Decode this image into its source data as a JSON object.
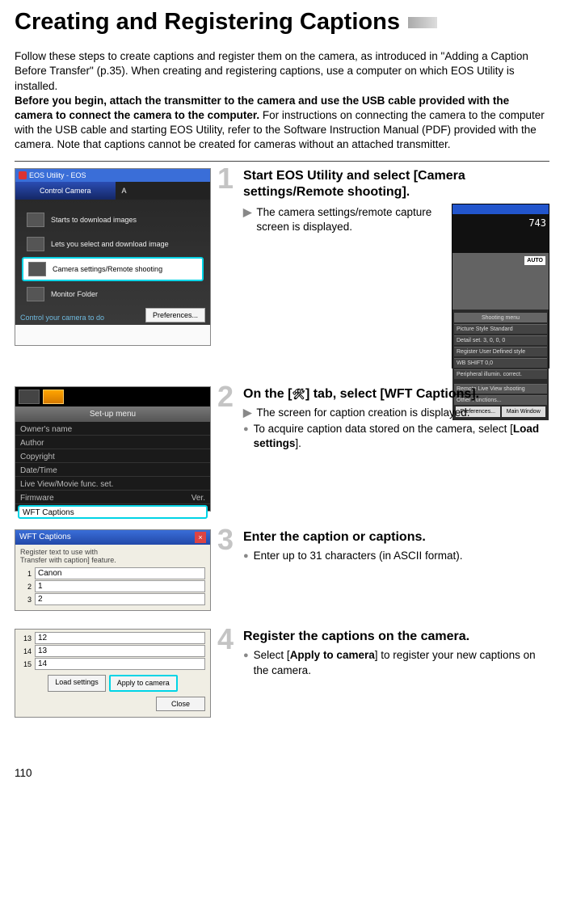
{
  "title": "Creating and Registering Captions",
  "intro_p1": "Follow these steps to create captions and register them on the camera, as introduced in \"Adding a Caption Before Transfer\" (p.35). When creating and registering captions, use a computer on which EOS Utility is installed.",
  "intro_bold": "Before you begin, attach the transmitter to the camera and use the USB cable provided with the camera to connect the camera to the computer.",
  "intro_p2": " For instructions on connecting the camera to the computer with the USB cable and starting EOS Utility, refer to the Software Instruction Manual (PDF) provided with the camera. Note that captions cannot be created for cameras without an attached transmitter.",
  "page_number": "110",
  "steps": {
    "1": {
      "num": "1",
      "title": "Start EOS Utility and select [Camera settings/Remote shooting].",
      "b1": "The camera settings/remote capture screen is displayed."
    },
    "2": {
      "num": "2",
      "title_pre": "On the [",
      "title_post": "] tab, select [WFT Captions].",
      "b1": "The screen for caption creation is displayed.",
      "b2_pre": "To acquire caption data stored on the camera, select [",
      "b2_bold": "Load settings",
      "b2_post": "]."
    },
    "3": {
      "num": "3",
      "title": "Enter the caption or captions.",
      "b1": "Enter up to 31 characters (in ASCII format)."
    },
    "4": {
      "num": "4",
      "title": "Register the captions on the camera.",
      "b1_pre": "Select [",
      "b1_bold": "Apply to camera",
      "b1_post": "] to register your new captions on the camera."
    }
  },
  "shot1": {
    "title": "EOS Utility - EOS",
    "tab1": "Control Camera",
    "tab2": "A",
    "row1": "Starts to download images",
    "row2": "Lets you select and download image",
    "row3": "Camera settings/Remote shooting",
    "row4": "Monitor Folder",
    "ctl": "Control your camera to do",
    "pref": "Preferences..."
  },
  "remote": {
    "num": "743",
    "badge": "AUTO",
    "r1": "Shooting menu",
    "r2": "Picture Style        Standard",
    "r3": "Detail set.          3, 0, 0, 0",
    "r4": "Register User Defined style",
    "r5": "WB SHIFT             0,0",
    "r6": "Peripheral illumin. correct.",
    "r7": "Remote Live View shooting",
    "r8": "Other Functions...",
    "btn1": "Preferences...",
    "btn2": "Main Window"
  },
  "shot2": {
    "header": "Set-up menu",
    "r1": "Owner's name",
    "r2": "Author",
    "r3": "Copyright",
    "r4": "Date/Time",
    "r5": "Live View/Movie func. set.",
    "r6": "Firmware",
    "r6b": "Ver.",
    "r7": "WFT Captions"
  },
  "shot3": {
    "title": "WFT Captions",
    "desc": "Register text to use with\nTransfer with caption] feature.",
    "c1": "Canon",
    "c2": "1",
    "c3": "2",
    "c12": "12",
    "c13": "13",
    "c14": "14",
    "btn_load": "Load settings",
    "btn_apply": "Apply to camera",
    "btn_close": "Close"
  }
}
